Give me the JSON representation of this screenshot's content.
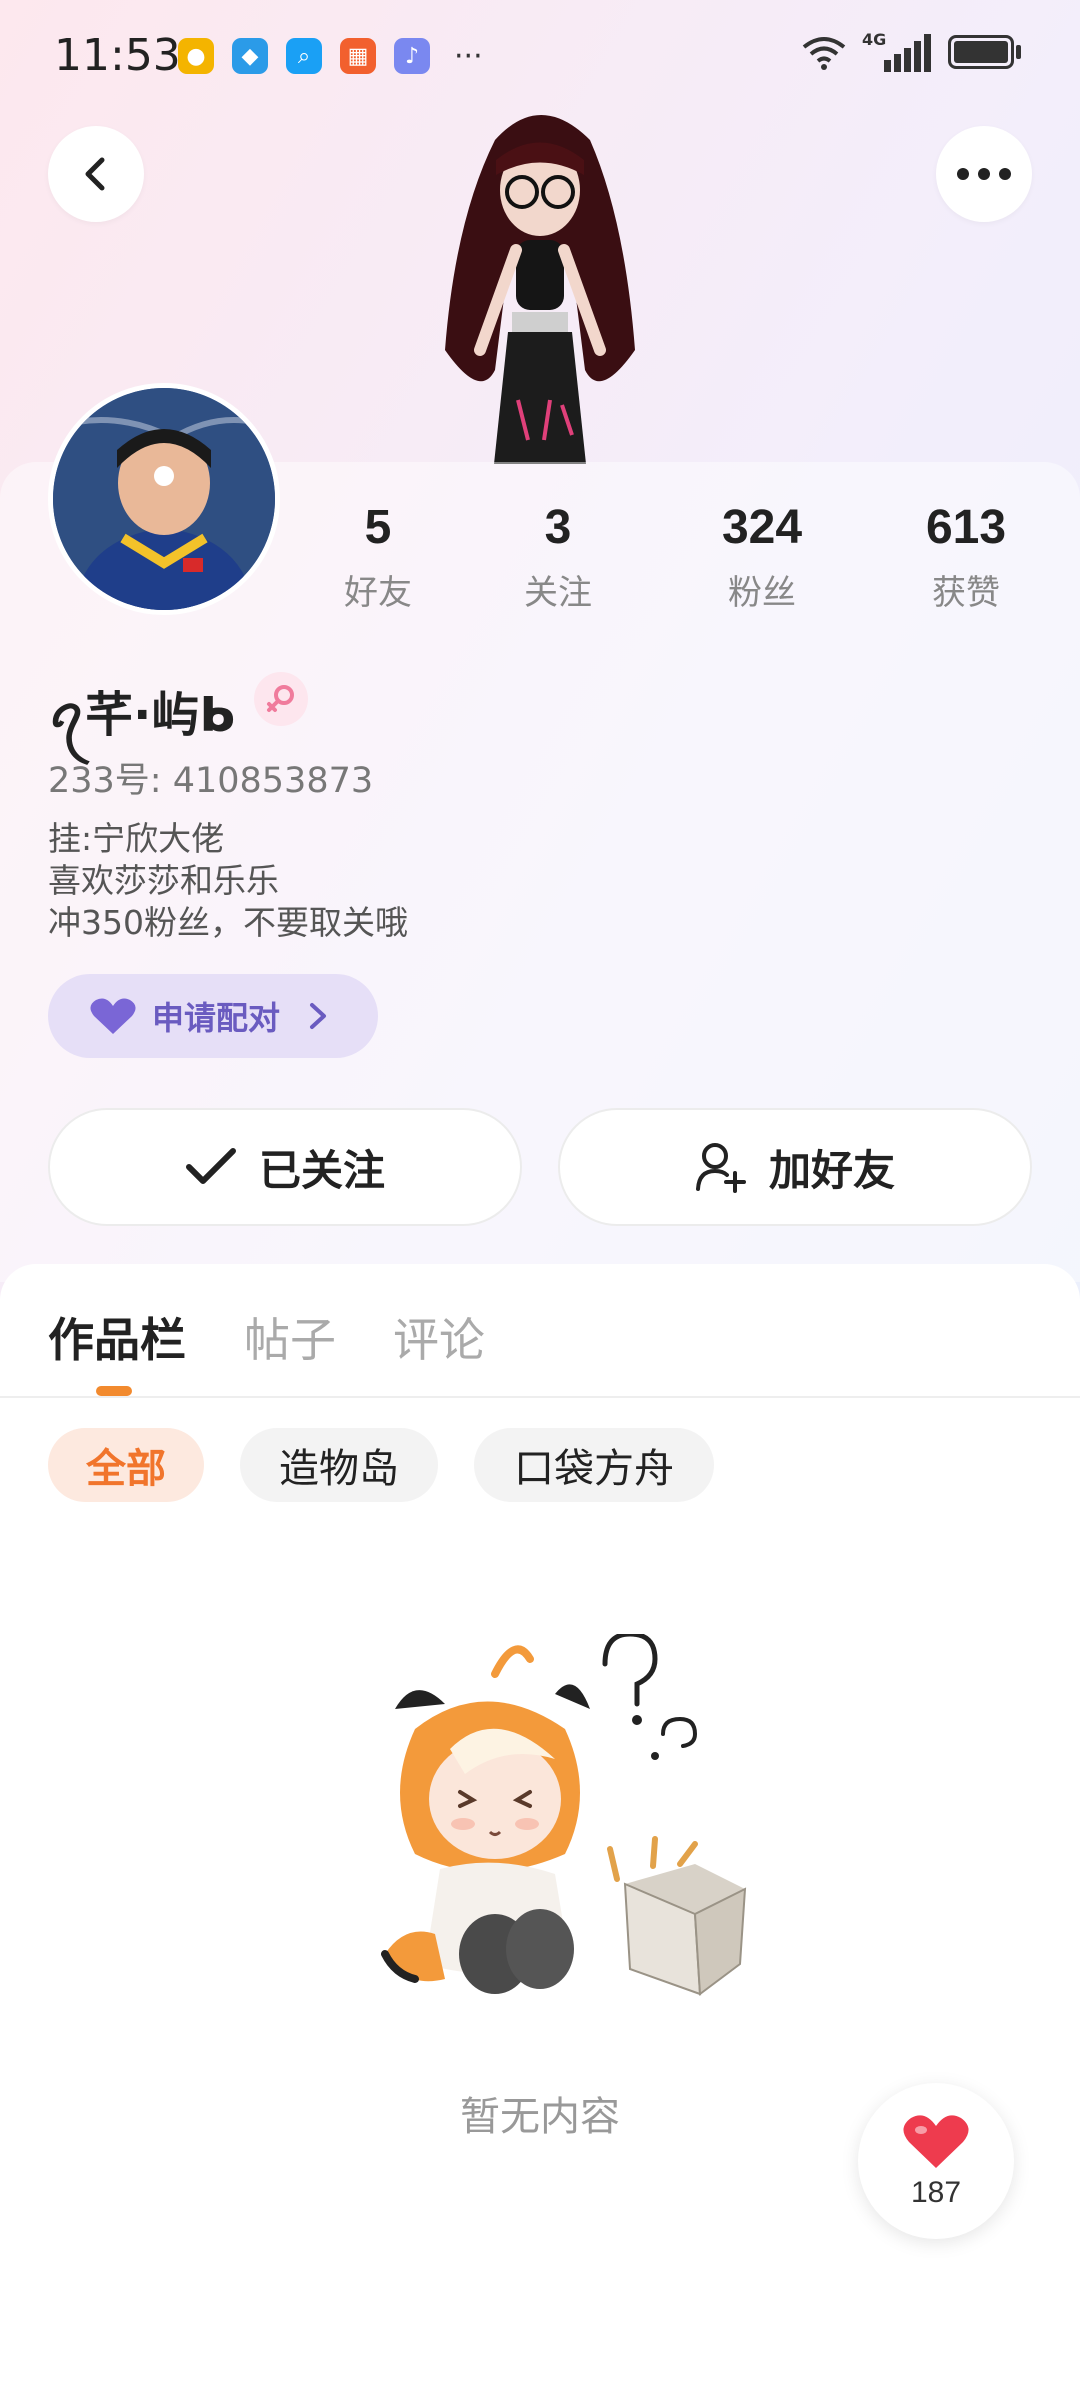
{
  "status_bar": {
    "time": "11:53",
    "network": "4G",
    "apps": [
      "weibo-icon",
      "browser-icon",
      "search-app-icon",
      "game-app-icon",
      "music-app-icon"
    ],
    "more": "···"
  },
  "profile": {
    "stats": [
      {
        "value": "5",
        "label": "好友"
      },
      {
        "value": "3",
        "label": "关注"
      },
      {
        "value": "324",
        "label": "粉丝"
      },
      {
        "value": "613",
        "label": "获赞"
      }
    ],
    "username": "ꪖ芊·屿ᖯ",
    "gender": "female",
    "id_label": "233号: 410853873",
    "bio": [
      "挂:宁欣大佬",
      "喜欢莎莎和乐乐",
      "冲350粉丝，不要取关哦"
    ],
    "pair_button": "申请配对",
    "follow_button": "已关注",
    "add_friend_button": "加好友"
  },
  "tabs": [
    {
      "label": "作品栏",
      "active": true
    },
    {
      "label": "帖子",
      "active": false
    },
    {
      "label": "评论",
      "active": false
    }
  ],
  "filters": [
    {
      "label": "全部",
      "active": true
    },
    {
      "label": "造物岛",
      "active": false
    },
    {
      "label": "口袋方舟",
      "active": false
    }
  ],
  "empty_state": {
    "text": "暂无内容"
  },
  "like_fab": {
    "count": "187"
  },
  "colors": {
    "accent": "#f1752c",
    "pair": "#6a5bc0",
    "heart": "#ee3b4e"
  }
}
